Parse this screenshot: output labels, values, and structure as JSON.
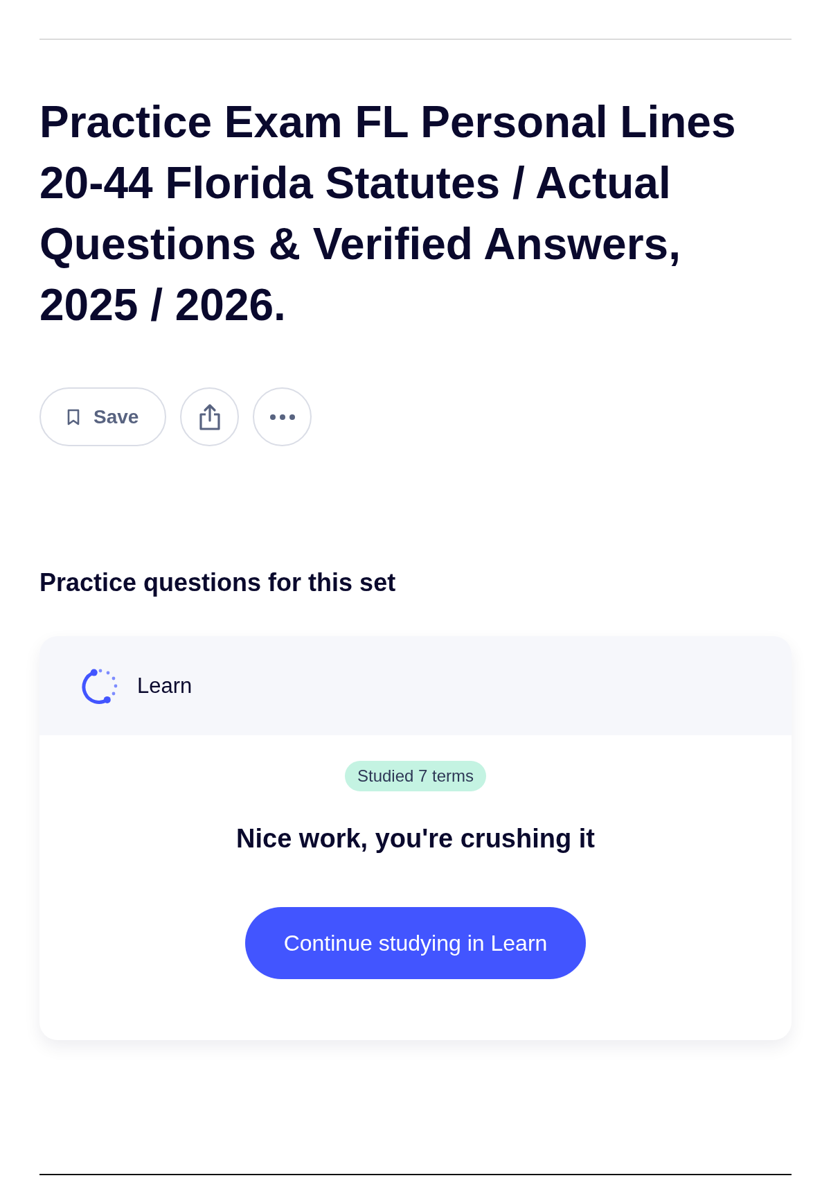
{
  "title": "Practice Exam FL Personal Lines 20-44 Florida Statutes / Actual Questions & Verified Answers, 2025 / 2026.",
  "actions": [
    {
      "kind": "save",
      "label": "Save"
    },
    {
      "kind": "share"
    },
    {
      "kind": "more"
    }
  ],
  "practice": {
    "heading": "Practice questions for this set",
    "mode": "Learn",
    "badge": "Studied 7 terms",
    "message": "Nice work, you're crushing it",
    "button": "Continue studying in Learn"
  }
}
